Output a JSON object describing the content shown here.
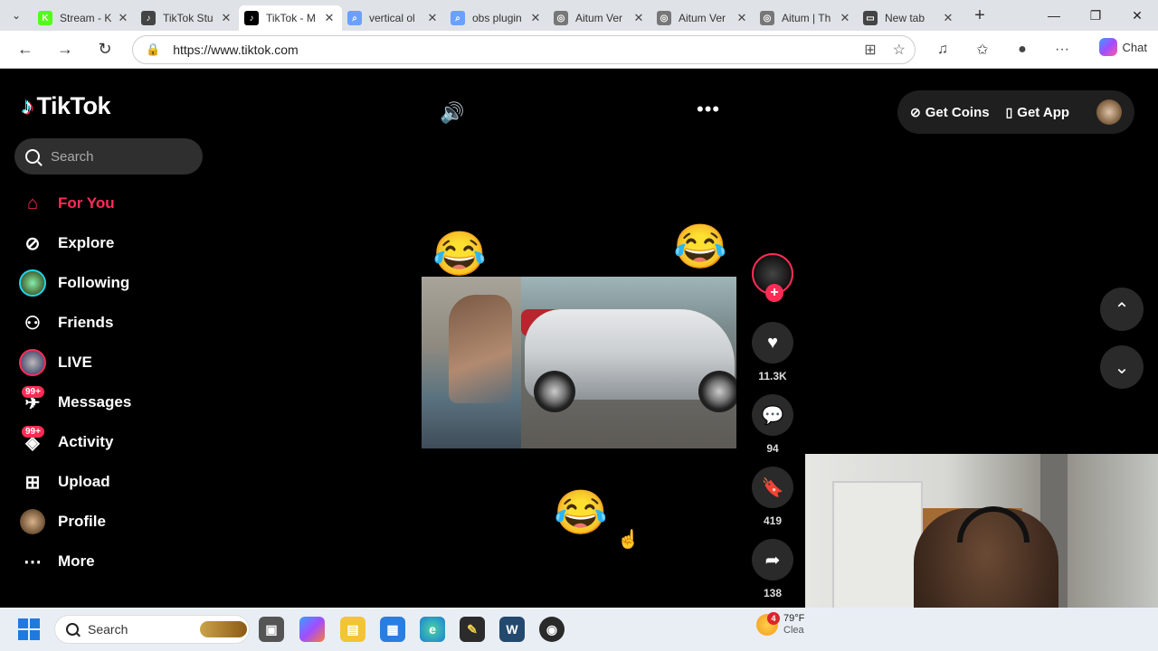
{
  "browser": {
    "tabs": [
      {
        "title": "Stream - K",
        "fav_color": "#53fc18",
        "fav_text": "K"
      },
      {
        "title": "TikTok Stu",
        "fav_color": "#444444",
        "fav_text": "♪"
      },
      {
        "title": "TikTok - M",
        "fav_color": "#000000",
        "fav_text": "♪",
        "active": true
      },
      {
        "title": "vertical ol",
        "fav_color": "#6aa0ff",
        "fav_text": "⌕"
      },
      {
        "title": "obs plugin",
        "fav_color": "#6aa0ff",
        "fav_text": "⌕"
      },
      {
        "title": "Aitum Ver",
        "fav_color": "#777777",
        "fav_text": "◎"
      },
      {
        "title": "Aitum Ver",
        "fav_color": "#777777",
        "fav_text": "◎"
      },
      {
        "title": "Aitum | Th",
        "fav_color": "#777777",
        "fav_text": "◎"
      },
      {
        "title": "New tab",
        "fav_color": "#444444",
        "fav_text": "▭"
      }
    ],
    "url": "https://www.tiktok.com",
    "chat_label": "Chat"
  },
  "sidebar": {
    "logo": "TikTok",
    "search_placeholder": "Search",
    "items": [
      {
        "label": "For You",
        "icon": "home-icon"
      },
      {
        "label": "Explore",
        "icon": "compass-icon"
      },
      {
        "label": "Following",
        "icon": "following-avatar"
      },
      {
        "label": "Friends",
        "icon": "friends-icon"
      },
      {
        "label": "LIVE",
        "icon": "live-avatar"
      },
      {
        "label": "Messages",
        "icon": "messages-icon",
        "badge": "99+"
      },
      {
        "label": "Activity",
        "icon": "activity-icon",
        "badge": "99+"
      },
      {
        "label": "Upload",
        "icon": "upload-icon"
      },
      {
        "label": "Profile",
        "icon": "profile-avatar"
      },
      {
        "label": "More",
        "icon": "more-icon"
      }
    ]
  },
  "header": {
    "get_coins": "Get Coins",
    "get_app": "Get App"
  },
  "actions": {
    "likes": "11.3K",
    "comments": "94",
    "saves": "419",
    "shares": "138"
  },
  "taskbar": {
    "search_placeholder": "Search",
    "weather_temp": "79°F",
    "weather_desc": "Clea",
    "notif_count": "4"
  },
  "colors": {
    "accent": "#fe2c55",
    "teal": "#25f4ee"
  }
}
